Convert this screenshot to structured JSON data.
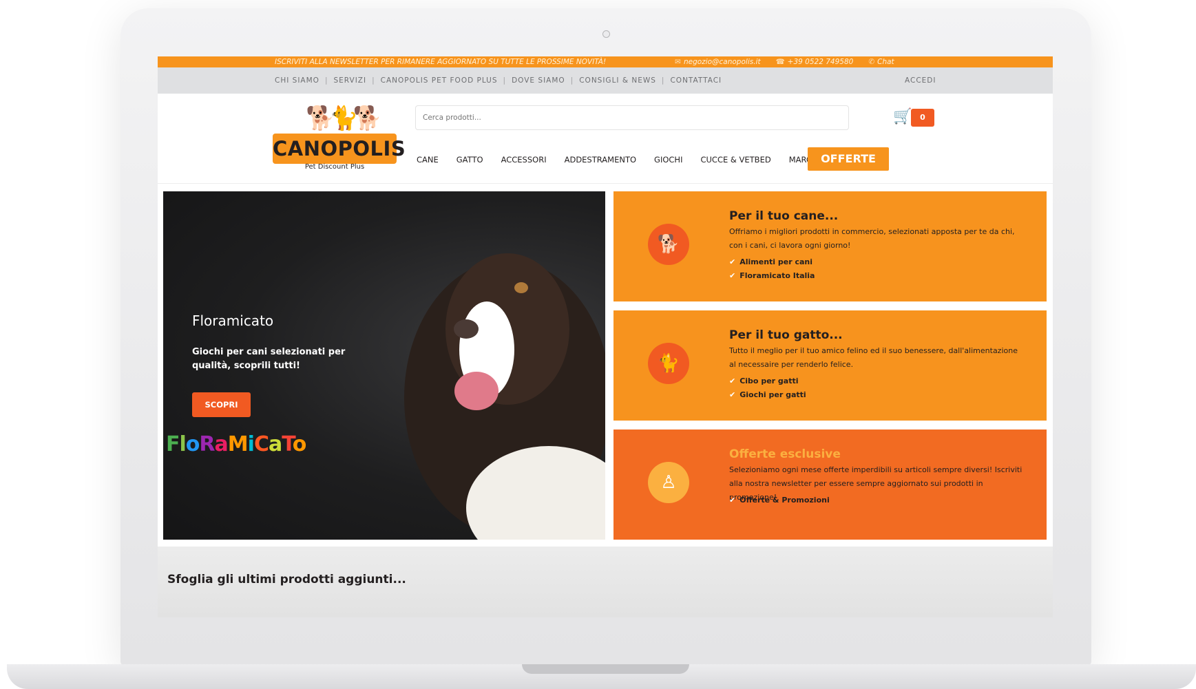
{
  "newsletter": {
    "text": "ISCRIVITI ALLA NEWSLETTER PER RIMANERE AGGIORNATO SU TUTTE LE PROSSIME NOVITÀ!",
    "email": "negozio@canopolis.it",
    "phone": "+39 0522 749580",
    "chat": "Chat"
  },
  "topnav": {
    "items": [
      "CHI SIAMO",
      "SERVIZI",
      "CANOPOLIS PET FOOD PLUS",
      "DOVE SIAMO",
      "CONSIGLI & NEWS",
      "CONTATTACI"
    ],
    "login": "ACCEDI"
  },
  "logo": {
    "name": "CANOPOLIS",
    "tagline": "Pet Discount Plus"
  },
  "search": {
    "placeholder": "Cerca prodotti..."
  },
  "cart": {
    "count": "0"
  },
  "categories": [
    "CANE",
    "GATTO",
    "ACCESSORI",
    "ADDESTRAMENTO",
    "GIOCHI",
    "CUCCE & VETBED",
    "MARCHI"
  ],
  "offers_button": "OFFERTE",
  "hero": {
    "title": "Floramicato",
    "text": "Giochi per cani selezionati per qualità, scoprili tutti!",
    "button": "SCOPRI",
    "brand": "FloRaMiCaTo"
  },
  "cards": [
    {
      "title": "Per il tuo cane...",
      "description": "Offriamo i migliori prodotti in commercio, selezionati apposta per te da chi, con i cani, ci lavora ogni giorno!",
      "items": [
        "Alimenti per cani",
        "Floramicato Italia"
      ],
      "bg": "#f7931e",
      "title_color": "#231f20",
      "icon": "dog-icon"
    },
    {
      "title": "Per il tuo gatto...",
      "description": "Tutto il meglio per il tuo amico felino ed il suo benessere, dall'alimentazione al necessaire per renderlo felice.",
      "items": [
        "Cibo per gatti",
        "Giochi per gatti"
      ],
      "bg": "#f7931e",
      "title_color": "#231f20",
      "icon": "cat-icon"
    },
    {
      "title": "Offerte esclusive",
      "description": "Selezioniamo ogni mese offerte imperdibili su articoli sempre diversi! Iscriviti alla nostra newsletter per essere sempre aggiornato sui prodotti in promozione!",
      "items": [
        "Offerte & Promozioni"
      ],
      "bg": "#f26b22",
      "title_color": "#fbb040",
      "icon": "person-icon"
    }
  ],
  "bottom": {
    "title": "Sfoglia gli ultimi prodotti aggiunti..."
  },
  "colors": {
    "accent": "#f7941d",
    "accent_dark": "#f15a22",
    "topnav_bg": "#dfe0e2"
  }
}
